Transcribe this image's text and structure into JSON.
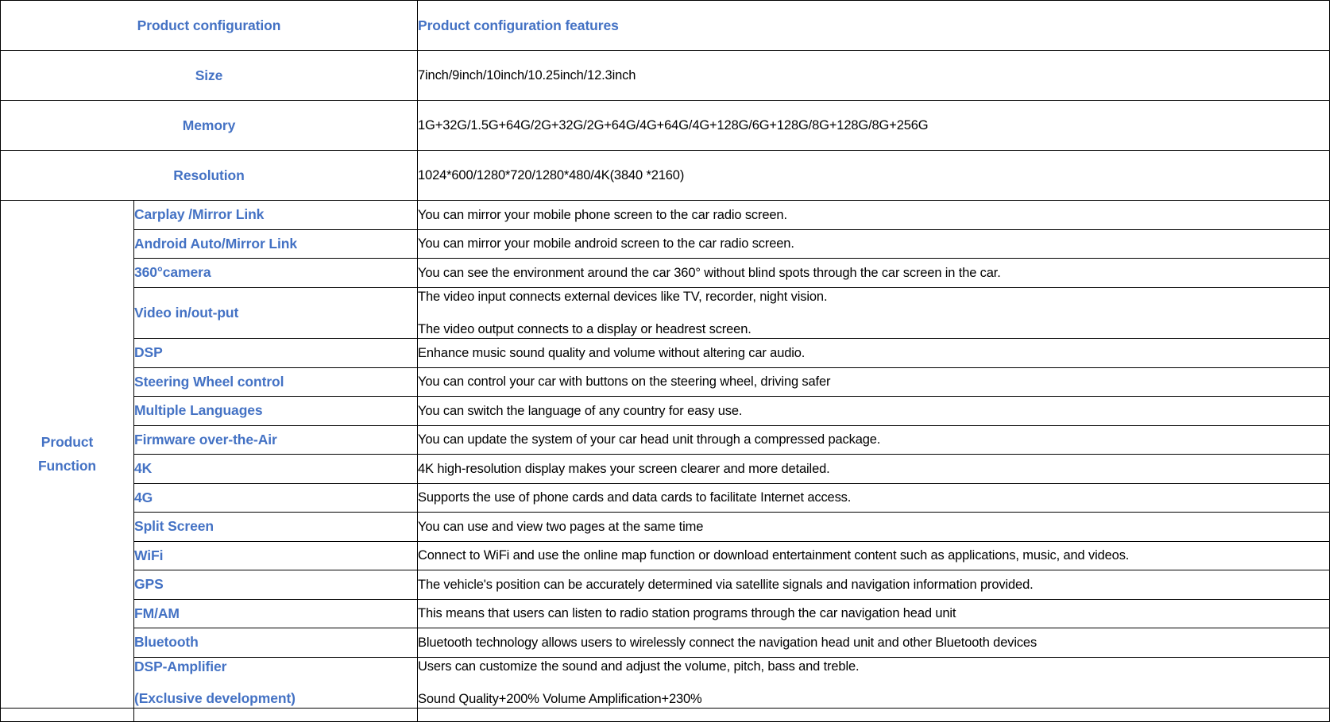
{
  "table": {
    "title_row": {
      "left_header": "Product configuration",
      "right_header": "Product configuration features"
    },
    "config_rows": [
      {
        "label": "Size",
        "value": "7inch/9inch/10inch/10.25inch/12.3inch"
      },
      {
        "label": "Memory",
        "value": "1G+32G/1.5G+64G/2G+32G/2G+64G/4G+64G/4G+128G/6G+128G/8G+128G/8G+256G"
      },
      {
        "label": "Resolution",
        "value": "1024*600/1280*720/1280*480/4K(3840 *2160)"
      }
    ],
    "function_group_label_line1": "Product",
    "function_group_label_line2": "Function",
    "function_rows": [
      {
        "label": "Carplay /Mirror Link",
        "desc": [
          "You can mirror your mobile phone screen to the car radio screen."
        ]
      },
      {
        "label": "Android Auto/Mirror Link",
        "desc": [
          "You can mirror your mobile android screen to the car radio screen."
        ]
      },
      {
        "label": "360°camera",
        "desc": [
          "You can see the environment around the car 360° without blind spots through the car screen in the car."
        ]
      },
      {
        "label": "Video in/out-put",
        "desc": [
          "The video input connects external devices like TV, recorder, night vision.",
          "The video output connects to a display or headrest screen."
        ]
      },
      {
        "label": "DSP",
        "desc": [
          "Enhance music sound quality and volume without altering car audio."
        ]
      },
      {
        "label": "Steering Wheel control",
        "desc": [
          "You can control your car with buttons on the steering wheel, driving safer"
        ]
      },
      {
        "label": "Multiple Languages",
        "desc": [
          "You can switch the language of any country for easy use."
        ]
      },
      {
        "label": "Firmware over-the-Air",
        "desc": [
          "You can update the system of your car head unit through a compressed package."
        ]
      },
      {
        "label": "4K",
        "desc": [
          "4K high-resolution display makes your screen clearer and more detailed."
        ]
      },
      {
        "label": "4G",
        "desc": [
          "Supports the use of phone cards and data cards to facilitate Internet access."
        ]
      },
      {
        "label": "Split Screen",
        "desc": [
          "You can use and view two pages at the same time"
        ]
      },
      {
        "label": "WiFi",
        "desc": [
          "Connect to WiFi and use the online map function or download entertainment content such as applications, music, and videos."
        ]
      },
      {
        "label": "GPS",
        "desc": [
          "The vehicle's position can be accurately determined via satellite signals and navigation information provided."
        ]
      },
      {
        "label": "FM/AM",
        "desc": [
          "This means that users can listen to radio station programs through the car navigation head unit"
        ]
      },
      {
        "label": "Bluetooth",
        "desc": [
          "Bluetooth technology allows users to wirelessly connect the navigation head unit and other Bluetooth devices"
        ]
      },
      {
        "label_lines": [
          "DSP-Amplifier",
          "(Exclusive development)"
        ],
        "desc": [
          "Users can customize the sound and adjust the volume, pitch, bass and treble.",
          "Sound Quality+200%   Volume Amplification+230%"
        ]
      }
    ],
    "colors": {
      "heading_blue": "#4472C4",
      "body_text": "#000000",
      "border": "#000000",
      "background": "#FFFFFF"
    }
  }
}
